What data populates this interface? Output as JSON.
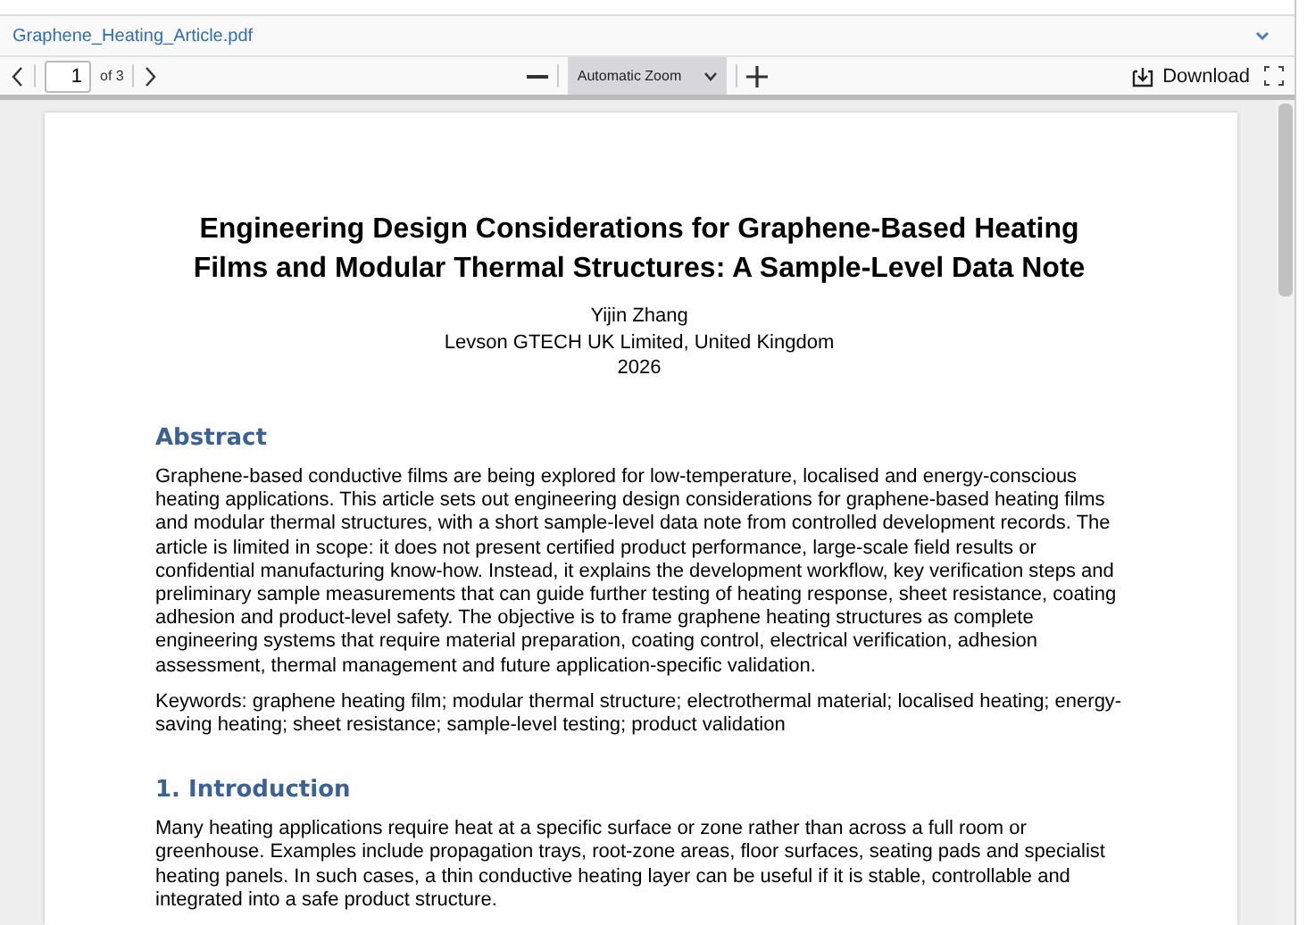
{
  "file_name": "Graphene_Heating_Article.pdf",
  "toolbar": {
    "page_number": "1",
    "page_count": "of 3",
    "zoom": "Automatic Zoom",
    "download": "Download"
  },
  "document": {
    "title": "Engineering Design Considerations for Graphene-Based Heating Films and Modular Thermal Structures: A Sample-Level Data Note",
    "author": "Yijin Zhang",
    "affiliation": "Levson GTECH UK Limited, United Kingdom",
    "year": "2026",
    "sections": [
      {
        "heading": "Abstract",
        "paragraphs": [
          "Graphene-based conductive films are being explored for low-temperature, localised and energy-conscious heating applications. This article sets out engineering design considerations for graphene-based heating films and modular thermal structures, with a short sample-level data note from controlled development records. The article is limited in scope: it does not present certified product performance, large-scale field results or confidential manufacturing know-how. Instead, it explains the development workflow, key verification steps and preliminary sample measurements that can guide further testing of heating response, sheet resistance, coating adhesion and product-level safety. The objective is to frame graphene heating structures as complete engineering systems that require material preparation, coating control, electrical verification, adhesion assessment, thermal management and future application-specific validation.",
          "Keywords: graphene heating film; modular thermal structure; electrothermal material; localised heating; energy-saving heating; sheet resistance; sample-level testing; product validation"
        ]
      },
      {
        "heading": "1. Introduction",
        "paragraphs": [
          "Many heating applications require heat at a specific surface or zone rather than across a full room or greenhouse. Examples include propagation trays, root-zone areas, floor surfaces, seating pads and specialist heating panels. In such cases, a thin conductive heating layer can be useful if it is stable, controllable and integrated into a safe product structure."
        ]
      }
    ]
  }
}
